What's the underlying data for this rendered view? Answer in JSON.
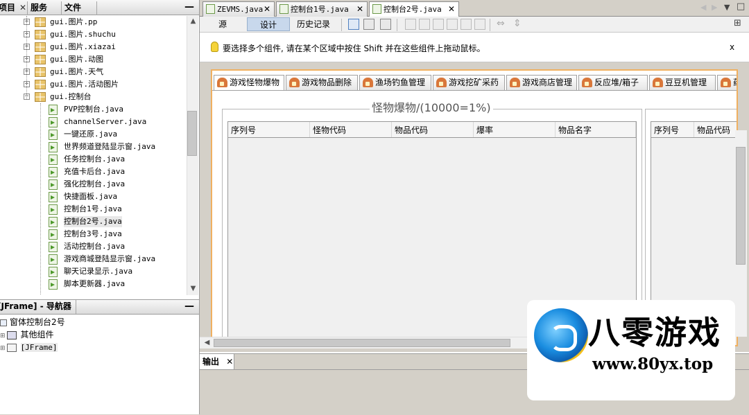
{
  "projects_panel": {
    "tabs": [
      {
        "label": "项目",
        "close": "✕"
      },
      {
        "label": "服务"
      },
      {
        "label": "文件"
      }
    ],
    "minimize": "—",
    "tree": [
      {
        "kind": "pkg",
        "label": "gui.图片.pp",
        "indent": 0
      },
      {
        "kind": "pkg",
        "label": "gui.图片.shuchu",
        "indent": 0
      },
      {
        "kind": "pkg",
        "label": "gui.图片.xiazai",
        "indent": 0
      },
      {
        "kind": "pkg",
        "label": "gui.图片.动图",
        "indent": 0
      },
      {
        "kind": "pkg",
        "label": "gui.图片.天气",
        "indent": 0
      },
      {
        "kind": "pkg",
        "label": "gui.图片.活动图片",
        "indent": 0
      },
      {
        "kind": "pkg-open",
        "label": "gui.控制台",
        "indent": 0
      },
      {
        "kind": "java",
        "label": "PVP控制台.java",
        "indent": 1
      },
      {
        "kind": "java",
        "label": "channelServer.java",
        "indent": 1
      },
      {
        "kind": "java",
        "label": "一键还原.java",
        "indent": 1
      },
      {
        "kind": "java",
        "label": "世界频道登陆显示窗.java",
        "indent": 1
      },
      {
        "kind": "java",
        "label": "任务控制台.java",
        "indent": 1
      },
      {
        "kind": "java",
        "label": "充值卡后台.java",
        "indent": 1
      },
      {
        "kind": "java",
        "label": "强化控制台.java",
        "indent": 1
      },
      {
        "kind": "java",
        "label": "快捷面板.java",
        "indent": 1
      },
      {
        "kind": "java",
        "label": "控制台1号.java",
        "indent": 1
      },
      {
        "kind": "java",
        "label": "控制台2号.java",
        "indent": 1,
        "selected": true
      },
      {
        "kind": "java",
        "label": "控制台3号.java",
        "indent": 1
      },
      {
        "kind": "java",
        "label": "活动控制台.java",
        "indent": 1
      },
      {
        "kind": "java",
        "label": "游戏商城登陆显示窗.java",
        "indent": 1
      },
      {
        "kind": "java",
        "label": "聊天记录显示.java",
        "indent": 1
      },
      {
        "kind": "java",
        "label": "脚本更新器.java",
        "indent": 1
      }
    ]
  },
  "navigator_panel": {
    "tab_label": "[JFrame] - 导航器",
    "close": "✕",
    "minimize": "—",
    "items": [
      {
        "label": "窗体控制台2号",
        "indent": 0
      },
      {
        "label": "其他组件",
        "indent": 1
      },
      {
        "label": "[JFrame]",
        "indent": 1
      }
    ]
  },
  "editor": {
    "tabs": [
      {
        "label": "ZEVMS.java",
        "close": "✕"
      },
      {
        "label": "控制台1号.java",
        "close": "✕"
      },
      {
        "label": "控制台2号.java",
        "close": "✕",
        "active": true
      }
    ],
    "toolbar": {
      "source_label": "源",
      "design_label": "设计",
      "history_label": "历史记录"
    },
    "hint": {
      "text": "要选择多个组件, 请在某个区域中按住 Shift 并在这些组件上拖动鼠标。",
      "close": "x"
    }
  },
  "form": {
    "tabs": [
      "游戏怪物爆物",
      "游戏物品删除",
      "渔场钓鱼管理",
      "游戏挖矿采药",
      "游戏商店管理",
      "反应堆/箱子",
      "豆豆机管理",
      "药水"
    ],
    "group_title": "怪物爆物/(10000=1%)",
    "table1_columns": [
      "序列号",
      "怪物代码",
      "物品代码",
      "爆率",
      "物品名字"
    ],
    "table2_columns": [
      "序列号",
      "物品代码"
    ]
  },
  "output_panel": {
    "tab_label": "输出",
    "close": "✕"
  },
  "watermark": {
    "title": "八零游戏",
    "url": "www.80yx.top"
  },
  "colors": {
    "selection": "#c8d8ec",
    "canvas_border": "#f0b060",
    "logo_blue": "#1a8de0"
  }
}
